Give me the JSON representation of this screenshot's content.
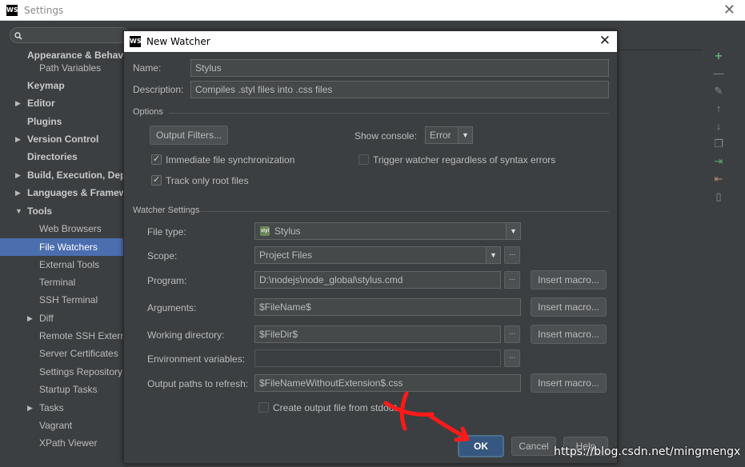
{
  "settings": {
    "title": "Settings",
    "logo": "WS",
    "close_glyph": "✕",
    "tree": [
      {
        "label": "Appearance & Behavior",
        "bold": true,
        "indent": 0
      },
      {
        "label": "Path Variables",
        "bold": false,
        "indent": 1
      },
      {
        "label": "Keymap",
        "bold": true,
        "indent": 0
      },
      {
        "label": "Editor",
        "bold": true,
        "indent": 0,
        "arrow": "▶"
      },
      {
        "label": "Plugins",
        "bold": true,
        "indent": 0
      },
      {
        "label": "Version Control",
        "bold": true,
        "indent": 0,
        "arrow": "▶"
      },
      {
        "label": "Directories",
        "bold": true,
        "indent": 0
      },
      {
        "label": "Build, Execution, Deployment",
        "bold": true,
        "indent": 0,
        "arrow": "▶"
      },
      {
        "label": "Languages & Frameworks",
        "bold": true,
        "indent": 0,
        "arrow": "▶"
      },
      {
        "label": "Tools",
        "bold": true,
        "indent": 0,
        "arrow": "▼"
      },
      {
        "label": "Web Browsers",
        "bold": false,
        "indent": 1
      },
      {
        "label": "File Watchers",
        "bold": false,
        "indent": 1,
        "selected": true
      },
      {
        "label": "External Tools",
        "bold": false,
        "indent": 1
      },
      {
        "label": "Terminal",
        "bold": false,
        "indent": 1
      },
      {
        "label": "SSH Terminal",
        "bold": false,
        "indent": 1
      },
      {
        "label": "Diff",
        "bold": false,
        "indent": 1,
        "arrow": "▶"
      },
      {
        "label": "Remote SSH External Tools",
        "bold": false,
        "indent": 1
      },
      {
        "label": "Server Certificates",
        "bold": false,
        "indent": 1
      },
      {
        "label": "Settings Repository",
        "bold": false,
        "indent": 1
      },
      {
        "label": "Startup Tasks",
        "bold": false,
        "indent": 1
      },
      {
        "label": "Tasks",
        "bold": false,
        "indent": 1,
        "arrow": "▶"
      },
      {
        "label": "Vagrant",
        "bold": false,
        "indent": 1
      },
      {
        "label": "XPath Viewer",
        "bold": false,
        "indent": 1
      }
    ],
    "toolbar_icons": [
      "add-icon",
      "remove-icon",
      "edit-icon",
      "move-up-icon",
      "move-down-icon",
      "copy-icon",
      "import-icon",
      "export-icon",
      "trash-icon"
    ]
  },
  "dialog": {
    "title": "New Watcher",
    "logo": "WS",
    "close_glyph": "✕",
    "name_label": "Name:",
    "name_value": "Stylus",
    "description_label": "Description:",
    "description_value": "Compiles .styl files into .css files",
    "options_title": "Options",
    "output_filters_button": "Output Filters...",
    "show_console_label": "Show console:",
    "show_console_value": "Error",
    "immediate_sync_label": "Immediate file synchronization",
    "immediate_sync_checked": true,
    "trigger_watcher_label": "Trigger watcher regardless of syntax errors",
    "trigger_watcher_checked": false,
    "track_root_label": "Track only root files",
    "track_root_checked": true,
    "watcher_settings_title": "Watcher Settings",
    "file_type_label": "File type:",
    "file_type_value": "Stylus",
    "scope_label": "Scope:",
    "scope_value": "Project Files",
    "program_label": "Program:",
    "program_value": "D:\\nodejs\\node_global\\stylus.cmd",
    "arguments_label": "Arguments:",
    "arguments_value": "$FileName$",
    "working_dir_label": "Working directory:",
    "working_dir_value": "$FileDir$",
    "env_vars_label": "Environment variables:",
    "env_vars_value": "",
    "output_paths_label": "Output paths to refresh:",
    "output_paths_value": "$FileNameWithoutExtension$.css",
    "insert_macro_label": "Insert macro...",
    "ellipsis_label": "...",
    "create_output_label": "Create output file from stdout",
    "create_output_checked": false,
    "ok_label": "OK",
    "cancel_label": "Cancel",
    "help_label": "Help",
    "stylus_icon_text": "styl"
  },
  "watermark": "https://blog.csdn.net/mingmengx",
  "colors": {
    "background": "#3c3f41",
    "selection": "#4b6eaf",
    "ok_button": "#365880",
    "annotation": "#ff0000",
    "add_icon": "#59a869"
  }
}
